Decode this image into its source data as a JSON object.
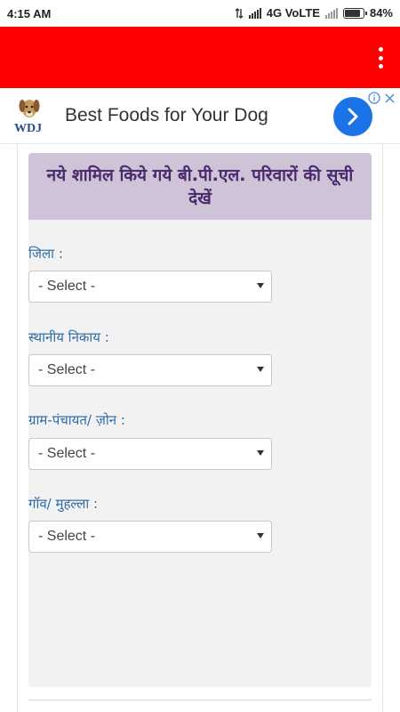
{
  "status_bar": {
    "time": "4:15 AM",
    "network": "4G VoLTE",
    "battery": "84%",
    "battery_level": 0.84
  },
  "app_bar": {
    "background": "#ff0000",
    "menu_icon": "more-vert-icon"
  },
  "ad": {
    "brand": "WDJ",
    "text": "Best Foods for Your Dog",
    "arrow_color": "#1a73e8",
    "info_icon": "info-icon",
    "close_icon": "close-icon"
  },
  "form": {
    "title": "नये शामिल किये गये बी.पी.एल. परिवारों की सूची देखें",
    "header_color": "#cfc3d7",
    "fields": [
      {
        "label": "जिला :",
        "value": "- Select -"
      },
      {
        "label": "स्थानीय निकाय :",
        "value": "- Select -"
      },
      {
        "label": "ग्राम-पंचायत/ ज़ोन :",
        "value": "- Select -"
      },
      {
        "label": "गॉव/ मुहल्ला :",
        "value": "- Select -"
      }
    ]
  }
}
